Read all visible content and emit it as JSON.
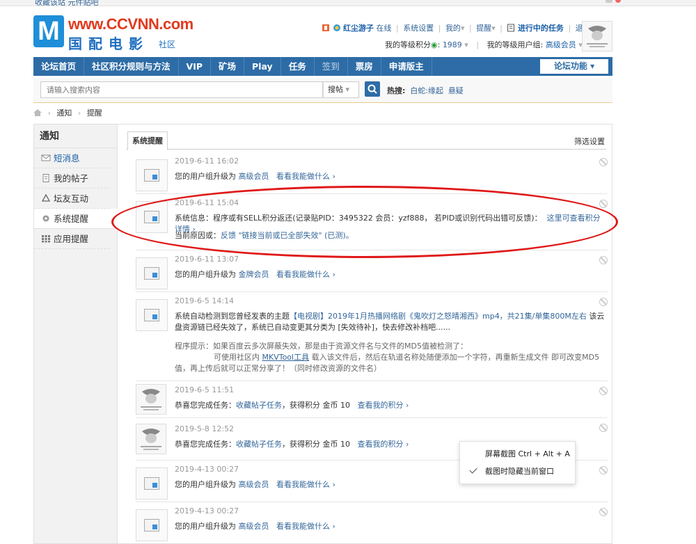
{
  "topbar": {
    "left_text": "收藏该站 元件贴吧"
  },
  "logo": {
    "letter": "M",
    "url": "www.CCVNN.com",
    "cn": "国配电影",
    "sub": "社区"
  },
  "user": {
    "name": "红尘游子",
    "status": "在线",
    "links": [
      "系统设置",
      "我的",
      "提醒"
    ],
    "task_link": "进行中的任务",
    "logout": "退出",
    "points_label": "我的等级积分",
    "points_value": "1989",
    "group_label": "我的等级用户组:",
    "group_value": "高级会员"
  },
  "nav": {
    "items": [
      "论坛首页",
      "社区积分规则与方法",
      "VIP",
      "矿场",
      "Play",
      "任务",
      "签到",
      "票房",
      "申请版主"
    ],
    "forum_button": "论坛功能"
  },
  "search": {
    "placeholder": "请输入搜索内容",
    "type": "搜帖",
    "hot_label": "热搜:",
    "hot_items": [
      "白蛇:缘起",
      "悬疑"
    ]
  },
  "breadcrumb": [
    "通知",
    "提醒"
  ],
  "sidebar": {
    "title": "通知",
    "items": [
      "短消息",
      "我的帖子",
      "坛友互动",
      "系统提醒",
      "应用提醒"
    ]
  },
  "main": {
    "tab": "系统提醒",
    "filter": "筛选设置"
  },
  "notices": [
    {
      "time": "2019-6-11 16:02",
      "text": "您的用户组升级为",
      "group": "高级会员",
      "action": "看看我能做什么 ›"
    },
    {
      "time": "2019-6-11 15:04",
      "text": "系统信息：程序或有SELL积分返还(记录贴PID：3495322 会员：yzf888， 若PID或识别代码出错可反馈)：",
      "link": "这里可查看积分详情 ›",
      "reason_label": "当前原因或：",
      "reason": "反馈 \"链接当前或已全部失效\" (已测)。"
    },
    {
      "time": "2019-6-11 13:07",
      "text": "您的用户组升级为",
      "group": "金牌会员",
      "action": "看看我能做什么 ›"
    },
    {
      "time": "2019-6-5 14:14",
      "p1a": "系统自动检测到您曾经发表的主题",
      "p1link": "【电视剧】2019年1月热播网络剧《鬼吹灯之怒晴湘西》mp4，共21集/单集800M左右",
      "p1b": "该云盘资源链已经失效了，系统已自动变更其分类为 [失效待补]，快去修改补档吧......",
      "p2": "程序提示：如果百度云多次屏蔽失效，那是由于资源文件名与文件的MD5值被检测了：",
      "p3a": "可使用社区内",
      "p3link": "MKVTool工具",
      "p3b": "载入该文件后，然后在轨道名称处随便添加一个字符，再重新生成文件 即可改变MD5值，再上传后就可以正常分享了！（同时修改资源的文件名）"
    },
    {
      "time": "2019-6-5 11:51",
      "text": "恭喜您完成任务：",
      "task": "收藏帖子任务",
      "text2": "，获得积分 金币 10",
      "action": "查看我的积分 ›"
    },
    {
      "time": "2019-5-8 12:52",
      "text": "恭喜您完成任务：",
      "task": "收藏帖子任务",
      "text2": "，获得积分 金币 10",
      "action": "查看我的积分 ›"
    },
    {
      "time": "2019-4-13 00:27",
      "text": "您的用户组升级为",
      "group": "高级会员",
      "action": "看看我能做什么 ›"
    },
    {
      "time": "2019-4-13 00:27",
      "text": "您的用户组升级为",
      "group": "高级会员",
      "action": "看看我能做什么 ›"
    }
  ],
  "context_menu": {
    "items": [
      "屏幕截图 Ctrl + Alt + A",
      "截图时隐藏当前窗口"
    ]
  },
  "colors": {
    "nav": "#2d6ca6",
    "link": "#336699",
    "annotation": "#e01818"
  }
}
